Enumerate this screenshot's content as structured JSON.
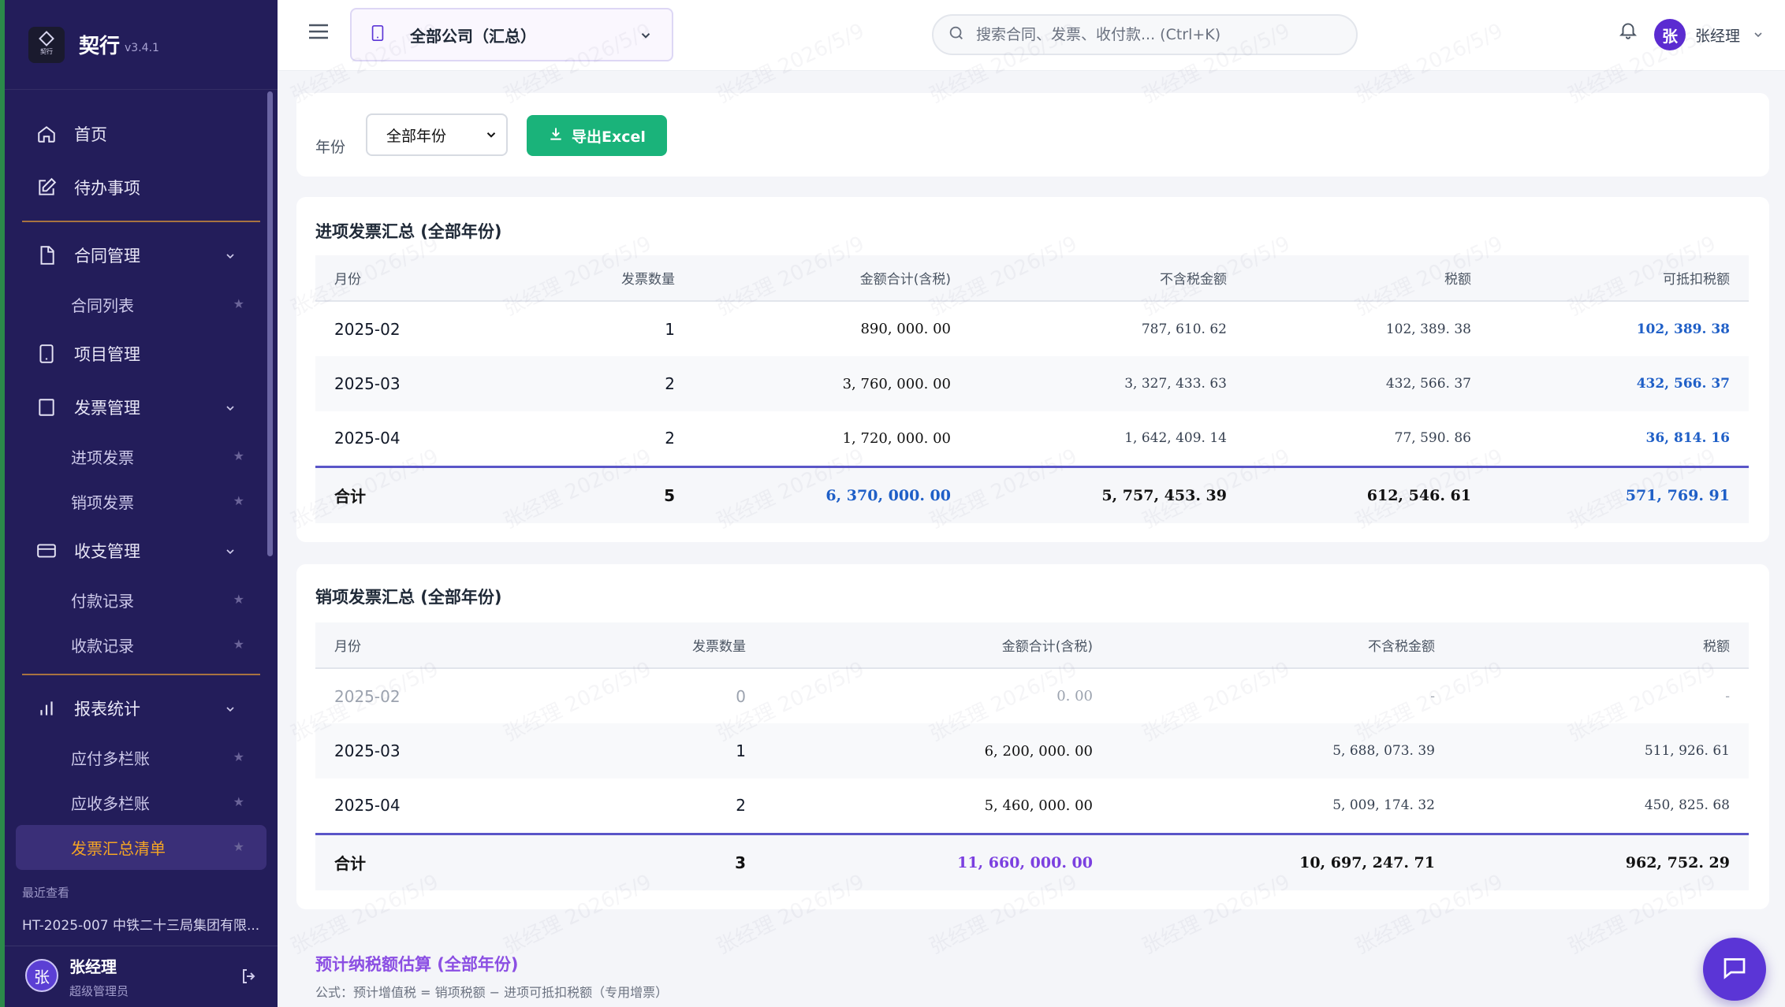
{
  "brand": {
    "name": "契行",
    "version": "v3.4.1",
    "logo_text": "契行"
  },
  "nav": {
    "home": "首页",
    "todo": "待办事项",
    "contract": "合同管理",
    "contract_list": "合同列表",
    "project": "项目管理",
    "invoice": "发票管理",
    "invoice_in": "进项发票",
    "invoice_out": "销项发票",
    "cash": "收支管理",
    "payment": "付款记录",
    "receipt": "收款记录",
    "report": "报表统计",
    "payable": "应付多栏账",
    "receivable": "应收多栏账",
    "invoice_summary": "发票汇总清单",
    "star": "★"
  },
  "recent": {
    "label": "最近查看",
    "item": "HT-2025-007 中铁二十三局集团有限..."
  },
  "user": {
    "name": "张经理",
    "role": "超级管理员",
    "initial": "张"
  },
  "header": {
    "company": "全部公司（汇总）",
    "search_placeholder": "搜索合同、发票、收付款... (Ctrl+K)",
    "user_name": "张经理",
    "user_initial": "张"
  },
  "filter": {
    "label": "年份",
    "year": "全部年份",
    "export": "导出Excel"
  },
  "input_invoices": {
    "title": "进项发票汇总 (全部年份)",
    "headers": [
      "月份",
      "发票数量",
      "金额合计(含税)",
      "不含税金额",
      "税额",
      "可抵扣税额"
    ],
    "rows": [
      [
        "2025-02",
        "1",
        "890, 000. 00",
        "787, 610. 62",
        "102, 389. 38",
        "102, 389. 38"
      ],
      [
        "2025-03",
        "2",
        "3, 760, 000. 00",
        "3, 327, 433. 63",
        "432, 566. 37",
        "432, 566. 37"
      ],
      [
        "2025-04",
        "2",
        "1, 720, 000. 00",
        "1, 642, 409. 14",
        "77, 590. 86",
        "36, 814. 16"
      ]
    ],
    "total": [
      "合计",
      "5",
      "6, 370, 000. 00",
      "5, 757, 453. 39",
      "612, 546. 61",
      "571, 769. 91"
    ]
  },
  "output_invoices": {
    "title": "销项发票汇总 (全部年份)",
    "headers": [
      "月份",
      "发票数量",
      "金额合计(含税)",
      "不含税金额",
      "税额"
    ],
    "rows": [
      [
        "2025-02",
        "0",
        "0. 00",
        "-",
        "-"
      ],
      [
        "2025-03",
        "1",
        "6, 200, 000. 00",
        "5, 688, 073. 39",
        "511, 926. 61"
      ],
      [
        "2025-04",
        "2",
        "5, 460, 000. 00",
        "5, 009, 174. 32",
        "450, 825. 68"
      ]
    ],
    "total": [
      "合计",
      "3",
      "11, 660, 000. 00",
      "10, 697, 247. 71",
      "962, 752. 29"
    ]
  },
  "estimate": {
    "title": "预计纳税额估算 (全部年份)",
    "formula": "公式：预计增值税 = 销项税额 − 进项可抵扣税额（专用增票）"
  },
  "watermark": "张经理 2026/5/9",
  "colors": {
    "sidebar": "#231d5a",
    "accent": "#5b35d6",
    "export": "#1ab37a",
    "active": "#f5a524"
  }
}
